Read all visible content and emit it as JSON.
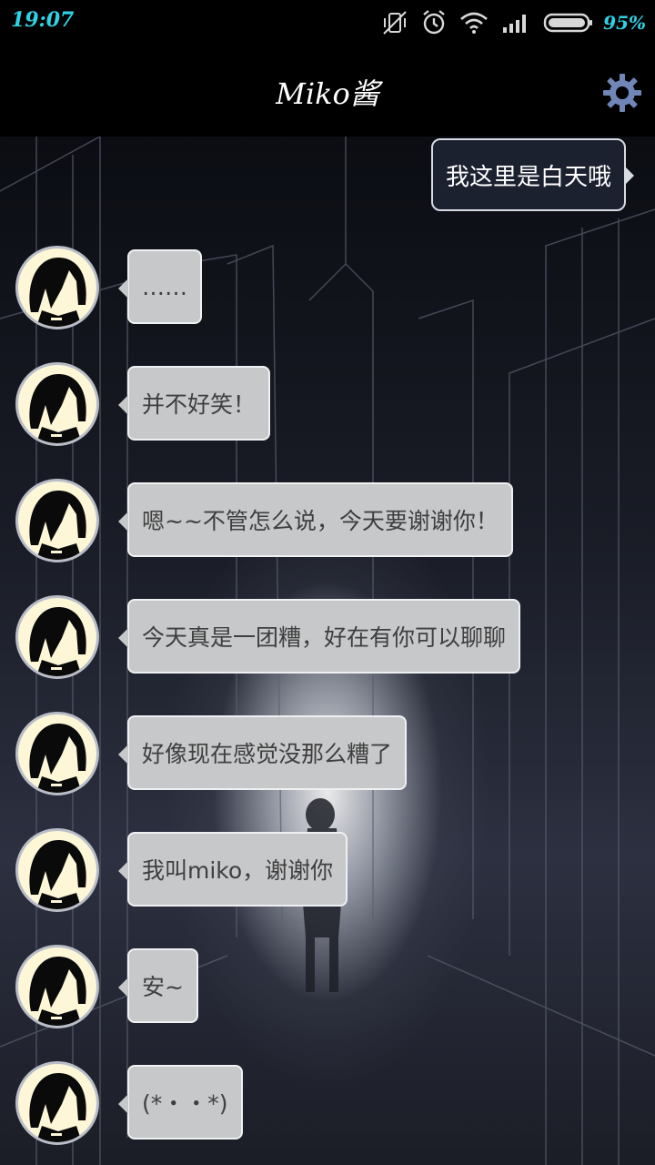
{
  "status_bar": {
    "time": "19:07",
    "battery_percent": "95%",
    "accent_color": "#2fd3e8",
    "icons": [
      "vibrate-off-icon",
      "alarm-icon",
      "wifi-icon",
      "signal-icon",
      "battery-icon"
    ]
  },
  "app_bar": {
    "title": "Miko酱",
    "settings_icon": "gear-icon"
  },
  "messages": [
    {
      "sender": "user",
      "text": "我这里是白天哦"
    },
    {
      "sender": "bot",
      "text": "……"
    },
    {
      "sender": "bot",
      "text": "并不好笑！"
    },
    {
      "sender": "bot",
      "text": "嗯~~不管怎么说，今天要谢谢你！"
    },
    {
      "sender": "bot",
      "text": "今天真是一团糟，好在有你可以聊聊"
    },
    {
      "sender": "bot",
      "text": "好像现在感觉没那么糟了"
    },
    {
      "sender": "bot",
      "text": "我叫miko，谢谢你"
    },
    {
      "sender": "bot",
      "text": "安~"
    },
    {
      "sender": "bot",
      "text": "(*・・*)"
    }
  ],
  "colors": {
    "bot_bubble": "#c7c8ca",
    "user_bubble": "#1c2130",
    "avatar_bg": "#fdf7d8"
  }
}
